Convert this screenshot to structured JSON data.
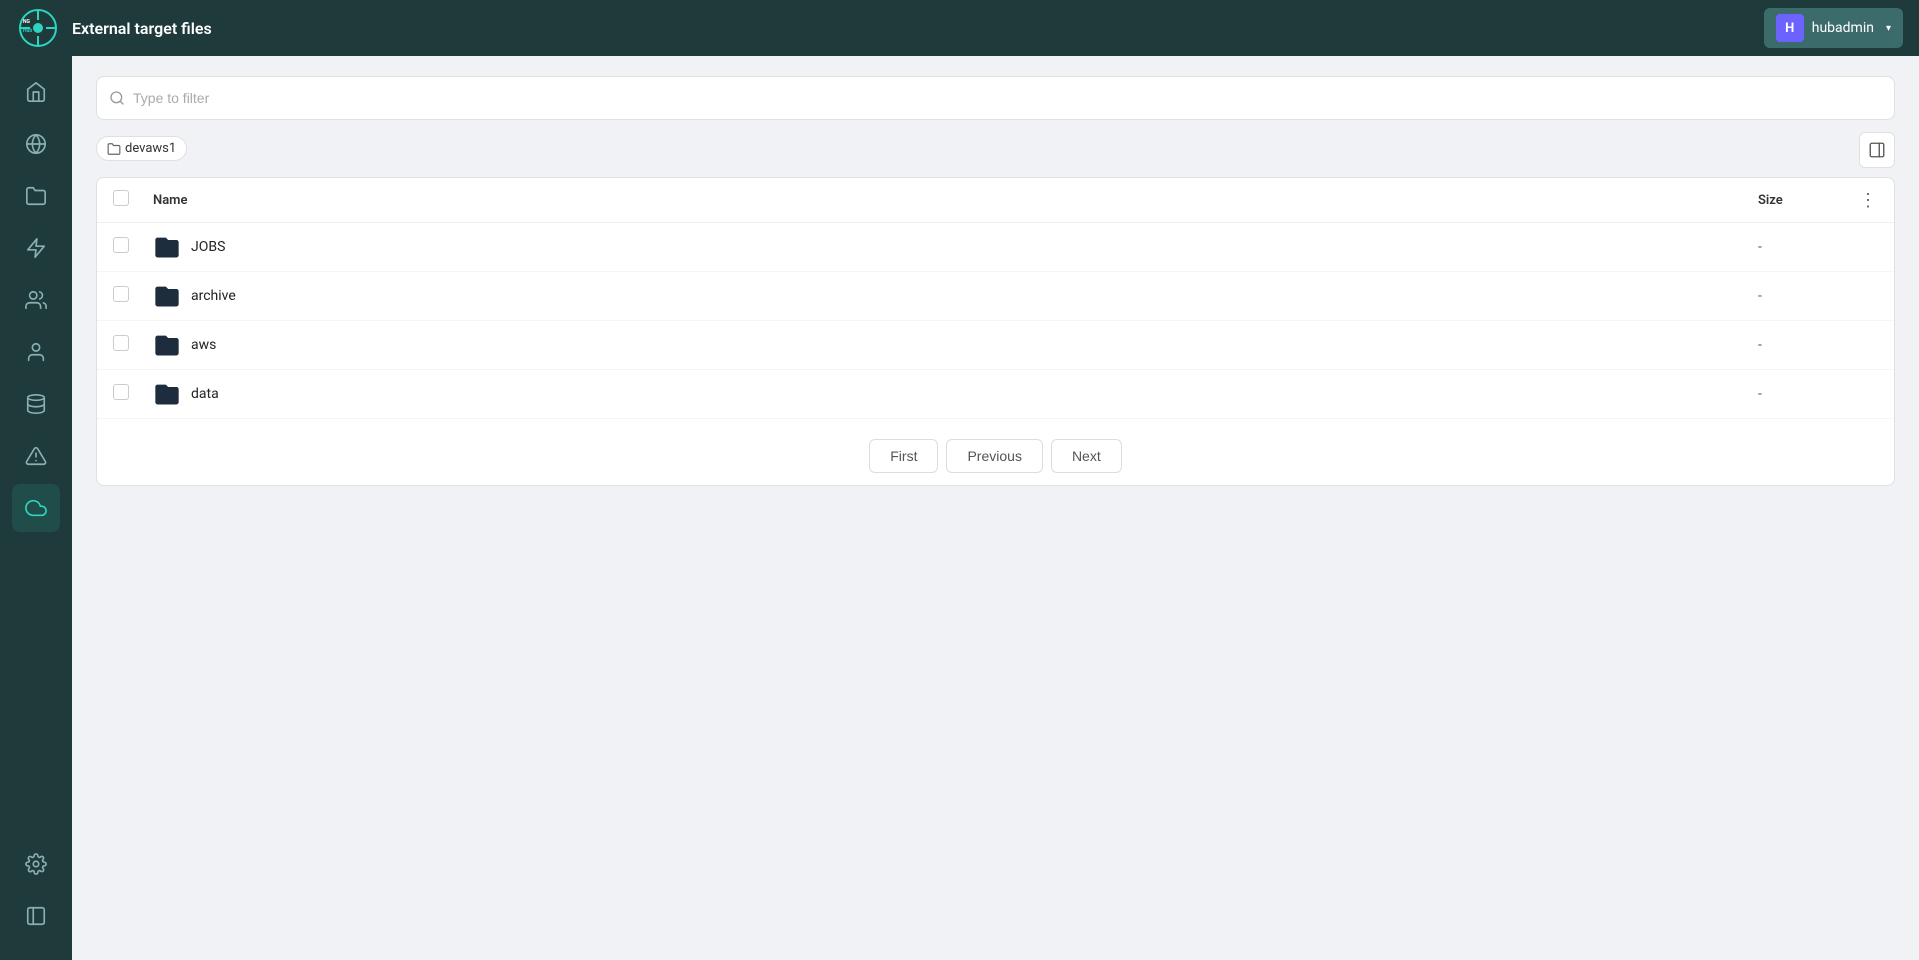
{
  "header": {
    "title": "External target files",
    "user": {
      "initial": "H",
      "name": "hubadmin"
    }
  },
  "search": {
    "placeholder": "Type to filter"
  },
  "breadcrumb": {
    "items": [
      {
        "label": "devaws1",
        "id": "devaws1"
      }
    ]
  },
  "table": {
    "columns": {
      "name": "Name",
      "size": "Size"
    },
    "rows": [
      {
        "id": "jobs",
        "name": "JOBS",
        "size": "-",
        "type": "folder"
      },
      {
        "id": "archive",
        "name": "archive",
        "size": "-",
        "type": "folder"
      },
      {
        "id": "aws",
        "name": "aws",
        "size": "-",
        "type": "folder"
      },
      {
        "id": "data",
        "name": "data",
        "size": "-",
        "type": "folder"
      }
    ]
  },
  "pagination": {
    "first": "First",
    "previous": "Previous",
    "next": "Next"
  },
  "sidebar": {
    "items": [
      {
        "id": "home",
        "icon": "home"
      },
      {
        "id": "network",
        "icon": "network"
      },
      {
        "id": "folder",
        "icon": "folder"
      },
      {
        "id": "lightning",
        "icon": "lightning"
      },
      {
        "id": "team",
        "icon": "team"
      },
      {
        "id": "user",
        "icon": "user"
      },
      {
        "id": "database",
        "icon": "database"
      },
      {
        "id": "alert",
        "icon": "alert"
      },
      {
        "id": "cloud",
        "icon": "cloud",
        "active": true
      }
    ],
    "bottom": [
      {
        "id": "settings",
        "icon": "settings"
      },
      {
        "id": "panel",
        "icon": "panel"
      }
    ]
  }
}
